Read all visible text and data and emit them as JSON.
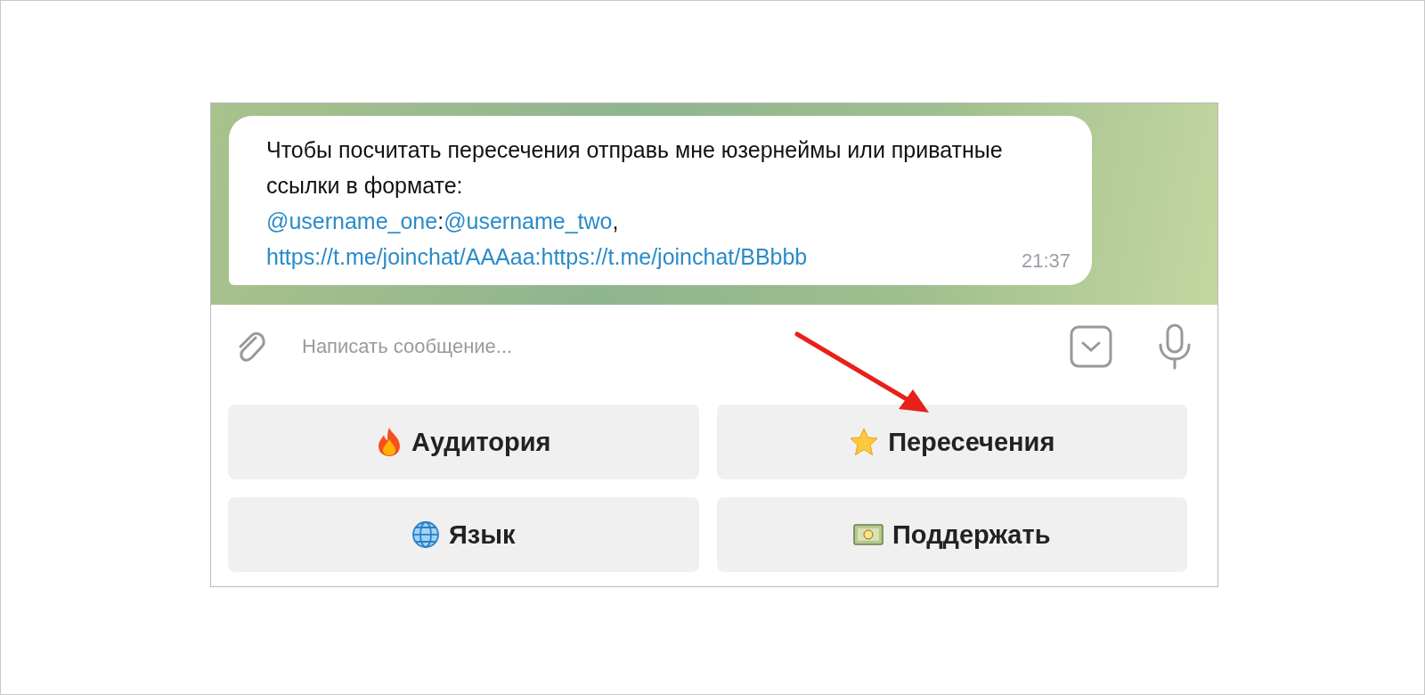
{
  "message": {
    "text": "Чтобы посчитать пересечения отправь мне юзернеймы или приватные ссылки в формате:",
    "parts": [
      {
        "kind": "link",
        "text": "@username_one"
      },
      {
        "kind": "plain",
        "text": ":"
      },
      {
        "kind": "link",
        "text": "@username_two"
      },
      {
        "kind": "plain",
        "text": ","
      },
      {
        "kind": "break"
      },
      {
        "kind": "link",
        "text": "https://t.me/joinchat/AAAaa:https://t.me/joinchat/BBbbb"
      }
    ],
    "time": "21:37"
  },
  "composer": {
    "placeholder": "Написать сообщение..."
  },
  "keyboard": [
    {
      "kind": "flame",
      "label": "Аудитория"
    },
    {
      "kind": "star",
      "label": "Пересечения"
    },
    {
      "kind": "globe",
      "label": "Язык"
    },
    {
      "kind": "banknote",
      "label": "Поддержать"
    }
  ]
}
